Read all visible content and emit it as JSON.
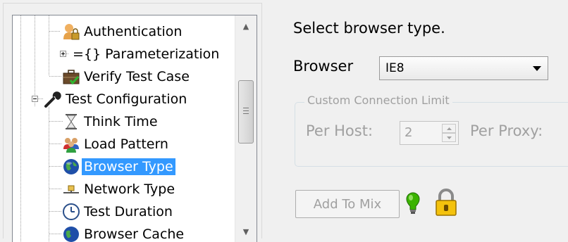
{
  "tree": {
    "items": [
      {
        "label": "Authentication",
        "icon": "authentication-user-lock-icon"
      },
      {
        "label": "={} Parameterization",
        "icon": "expander-plus-icon"
      },
      {
        "label": "Verify Test Case",
        "icon": "briefcase-check-icon"
      },
      {
        "label": "Test Configuration",
        "icon": "wrench-icon"
      },
      {
        "label": "Think Time",
        "icon": "hourglass-icon"
      },
      {
        "label": "Load Pattern",
        "icon": "users-group-icon"
      },
      {
        "label": "Browser Type",
        "icon": "globe-icon",
        "selected": true
      },
      {
        "label": "Network Type",
        "icon": "network-icon"
      },
      {
        "label": "Test Duration",
        "icon": "clock-icon"
      },
      {
        "label": "Browser Cache",
        "icon": "globe-cache-icon"
      }
    ]
  },
  "main": {
    "heading": "Select browser type.",
    "browser_label": "Browser",
    "browser_value": "IE8",
    "group_title": "Custom Connection Limit",
    "per_host_label": "Per Host:",
    "per_host_value": "2",
    "per_proxy_label": "Per Proxy:",
    "add_button": "Add To Mix"
  },
  "colors": {
    "selection": "#3399ff",
    "disabled_text": "#a0a0a0",
    "bulb": "#3bb300",
    "lock": "#f4c20d"
  }
}
